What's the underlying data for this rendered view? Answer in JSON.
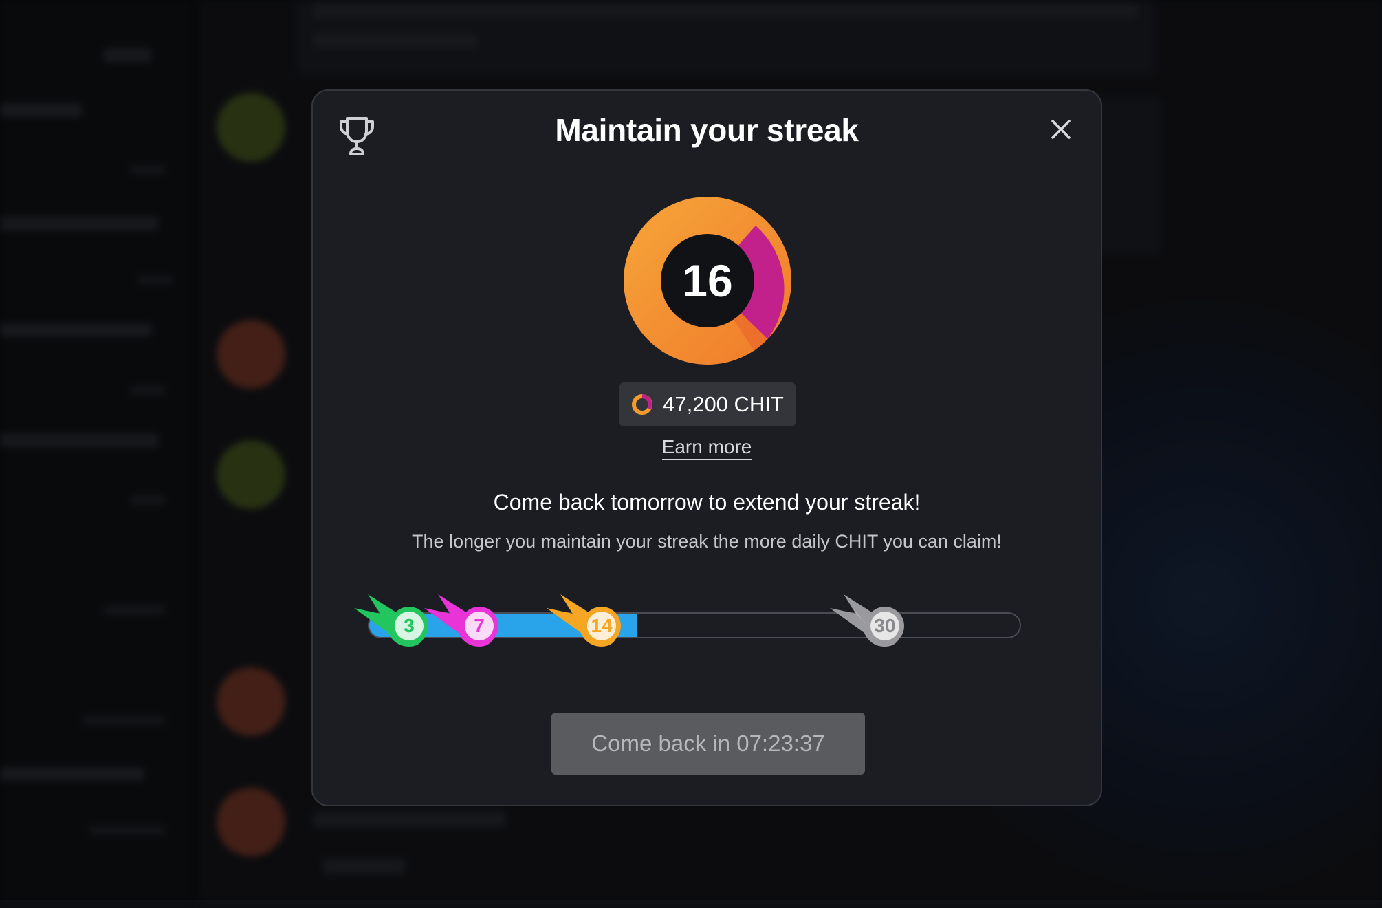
{
  "modal": {
    "title": "Maintain your streak",
    "streak_count": "16",
    "balance": "47,200 CHIT",
    "earn_more": "Earn more",
    "headline": "Come back tomorrow to extend your streak!",
    "subtext": "The longer you maintain your streak the more daily CHIT you can claim!",
    "cta": "Come back in 07:23:37",
    "icons": {
      "trophy": "trophy-icon",
      "close": "close-icon",
      "chit": "chit-token-icon"
    }
  },
  "progress": {
    "current_day": 16,
    "max_day": 30,
    "milestones": [
      {
        "label": "3",
        "color": "#22c55e"
      },
      {
        "label": "7",
        "color": "#e935d8"
      },
      {
        "label": "14",
        "color": "#f5a623"
      },
      {
        "label": "30",
        "color": "#9a9a9e"
      }
    ]
  },
  "colors": {
    "ring_orange": "#f59a2c",
    "ring_magenta": "#c2208a",
    "progress_fill": "#29a3ea",
    "modal_bg": "#1c1d22"
  }
}
